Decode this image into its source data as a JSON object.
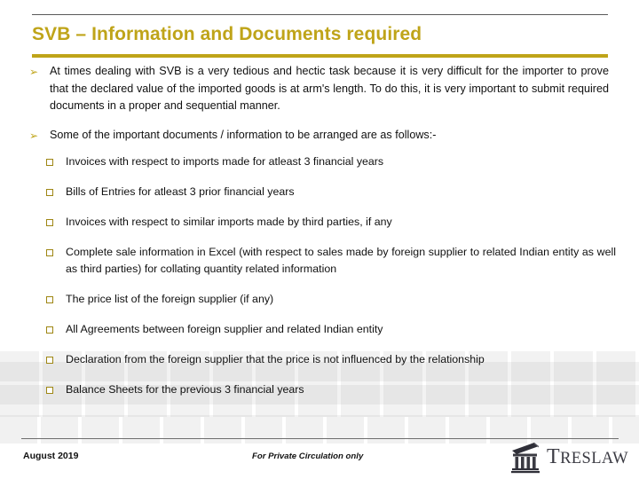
{
  "slide": {
    "title": "SVB – Information and Documents required",
    "accent_color": "#BFA419",
    "rule_color": "#595959",
    "bullet_arrow_glyph": "➢",
    "paragraphs": [
      {
        "marker": "arrow-bullet",
        "text": "At times dealing with SVB is a very tedious and hectic task because it is very difficult for the importer to prove that the declared value of the imported goods is at arm's length. To do this, it is very important to submit required documents in a proper and sequential manner."
      },
      {
        "marker": "arrow-bullet",
        "text": "Some of the important documents / information to be arranged are as follows:-"
      }
    ],
    "sub_items": [
      "Invoices with respect to imports made for atleast 3 financial years",
      "Bills of Entries for atleast 3 prior financial years",
      "Invoices with respect to similar imports made by third parties, if any",
      "Complete sale information in Excel (with respect to sales made by foreign supplier to related Indian entity as well as third parties) for collating quantity related information",
      "The price list of the foreign supplier (if any)",
      "All Agreements between foreign supplier and related Indian entity",
      "Declaration from the foreign supplier that the price is not influenced by the relationship",
      "Balance Sheets for the previous 3 financial years"
    ]
  },
  "footer": {
    "date": "August 2019",
    "note": "For Private Circulation only",
    "logo_icon": "classical-building-icon",
    "logo_word_cap": "T",
    "logo_word_rest": "RESLAW",
    "logo_color": "#3b3b43"
  }
}
